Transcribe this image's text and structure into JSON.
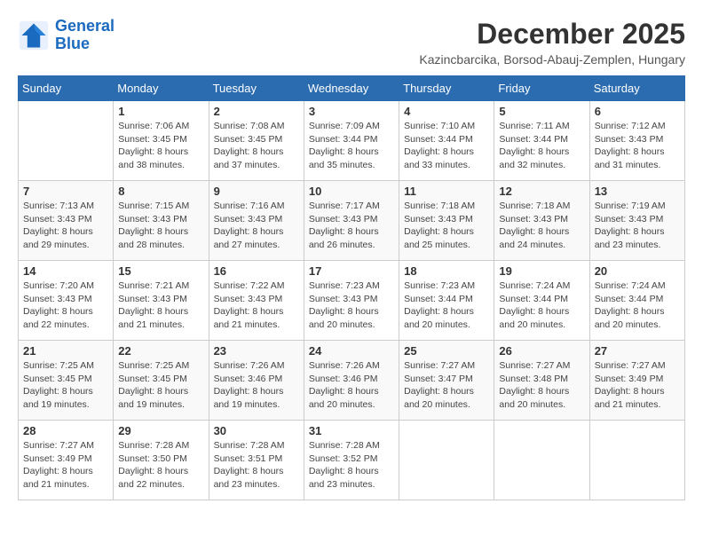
{
  "header": {
    "logo": {
      "line1": "General",
      "line2": "Blue"
    },
    "title": "December 2025",
    "location": "Kazincbarcika, Borsod-Abauj-Zemplen, Hungary"
  },
  "days_of_week": [
    "Sunday",
    "Monday",
    "Tuesday",
    "Wednesday",
    "Thursday",
    "Friday",
    "Saturday"
  ],
  "weeks": [
    [
      {
        "day": "",
        "info": ""
      },
      {
        "day": "1",
        "info": "Sunrise: 7:06 AM\nSunset: 3:45 PM\nDaylight: 8 hours\nand 38 minutes."
      },
      {
        "day": "2",
        "info": "Sunrise: 7:08 AM\nSunset: 3:45 PM\nDaylight: 8 hours\nand 37 minutes."
      },
      {
        "day": "3",
        "info": "Sunrise: 7:09 AM\nSunset: 3:44 PM\nDaylight: 8 hours\nand 35 minutes."
      },
      {
        "day": "4",
        "info": "Sunrise: 7:10 AM\nSunset: 3:44 PM\nDaylight: 8 hours\nand 33 minutes."
      },
      {
        "day": "5",
        "info": "Sunrise: 7:11 AM\nSunset: 3:44 PM\nDaylight: 8 hours\nand 32 minutes."
      },
      {
        "day": "6",
        "info": "Sunrise: 7:12 AM\nSunset: 3:43 PM\nDaylight: 8 hours\nand 31 minutes."
      }
    ],
    [
      {
        "day": "7",
        "info": "Sunrise: 7:13 AM\nSunset: 3:43 PM\nDaylight: 8 hours\nand 29 minutes."
      },
      {
        "day": "8",
        "info": "Sunrise: 7:15 AM\nSunset: 3:43 PM\nDaylight: 8 hours\nand 28 minutes."
      },
      {
        "day": "9",
        "info": "Sunrise: 7:16 AM\nSunset: 3:43 PM\nDaylight: 8 hours\nand 27 minutes."
      },
      {
        "day": "10",
        "info": "Sunrise: 7:17 AM\nSunset: 3:43 PM\nDaylight: 8 hours\nand 26 minutes."
      },
      {
        "day": "11",
        "info": "Sunrise: 7:18 AM\nSunset: 3:43 PM\nDaylight: 8 hours\nand 25 minutes."
      },
      {
        "day": "12",
        "info": "Sunrise: 7:18 AM\nSunset: 3:43 PM\nDaylight: 8 hours\nand 24 minutes."
      },
      {
        "day": "13",
        "info": "Sunrise: 7:19 AM\nSunset: 3:43 PM\nDaylight: 8 hours\nand 23 minutes."
      }
    ],
    [
      {
        "day": "14",
        "info": "Sunrise: 7:20 AM\nSunset: 3:43 PM\nDaylight: 8 hours\nand 22 minutes."
      },
      {
        "day": "15",
        "info": "Sunrise: 7:21 AM\nSunset: 3:43 PM\nDaylight: 8 hours\nand 21 minutes."
      },
      {
        "day": "16",
        "info": "Sunrise: 7:22 AM\nSunset: 3:43 PM\nDaylight: 8 hours\nand 21 minutes."
      },
      {
        "day": "17",
        "info": "Sunrise: 7:23 AM\nSunset: 3:43 PM\nDaylight: 8 hours\nand 20 minutes."
      },
      {
        "day": "18",
        "info": "Sunrise: 7:23 AM\nSunset: 3:44 PM\nDaylight: 8 hours\nand 20 minutes."
      },
      {
        "day": "19",
        "info": "Sunrise: 7:24 AM\nSunset: 3:44 PM\nDaylight: 8 hours\nand 20 minutes."
      },
      {
        "day": "20",
        "info": "Sunrise: 7:24 AM\nSunset: 3:44 PM\nDaylight: 8 hours\nand 20 minutes."
      }
    ],
    [
      {
        "day": "21",
        "info": "Sunrise: 7:25 AM\nSunset: 3:45 PM\nDaylight: 8 hours\nand 19 minutes."
      },
      {
        "day": "22",
        "info": "Sunrise: 7:25 AM\nSunset: 3:45 PM\nDaylight: 8 hours\nand 19 minutes."
      },
      {
        "day": "23",
        "info": "Sunrise: 7:26 AM\nSunset: 3:46 PM\nDaylight: 8 hours\nand 19 minutes."
      },
      {
        "day": "24",
        "info": "Sunrise: 7:26 AM\nSunset: 3:46 PM\nDaylight: 8 hours\nand 20 minutes."
      },
      {
        "day": "25",
        "info": "Sunrise: 7:27 AM\nSunset: 3:47 PM\nDaylight: 8 hours\nand 20 minutes."
      },
      {
        "day": "26",
        "info": "Sunrise: 7:27 AM\nSunset: 3:48 PM\nDaylight: 8 hours\nand 20 minutes."
      },
      {
        "day": "27",
        "info": "Sunrise: 7:27 AM\nSunset: 3:49 PM\nDaylight: 8 hours\nand 21 minutes."
      }
    ],
    [
      {
        "day": "28",
        "info": "Sunrise: 7:27 AM\nSunset: 3:49 PM\nDaylight: 8 hours\nand 21 minutes."
      },
      {
        "day": "29",
        "info": "Sunrise: 7:28 AM\nSunset: 3:50 PM\nDaylight: 8 hours\nand 22 minutes."
      },
      {
        "day": "30",
        "info": "Sunrise: 7:28 AM\nSunset: 3:51 PM\nDaylight: 8 hours\nand 23 minutes."
      },
      {
        "day": "31",
        "info": "Sunrise: 7:28 AM\nSunset: 3:52 PM\nDaylight: 8 hours\nand 23 minutes."
      },
      {
        "day": "",
        "info": ""
      },
      {
        "day": "",
        "info": ""
      },
      {
        "day": "",
        "info": ""
      }
    ]
  ]
}
